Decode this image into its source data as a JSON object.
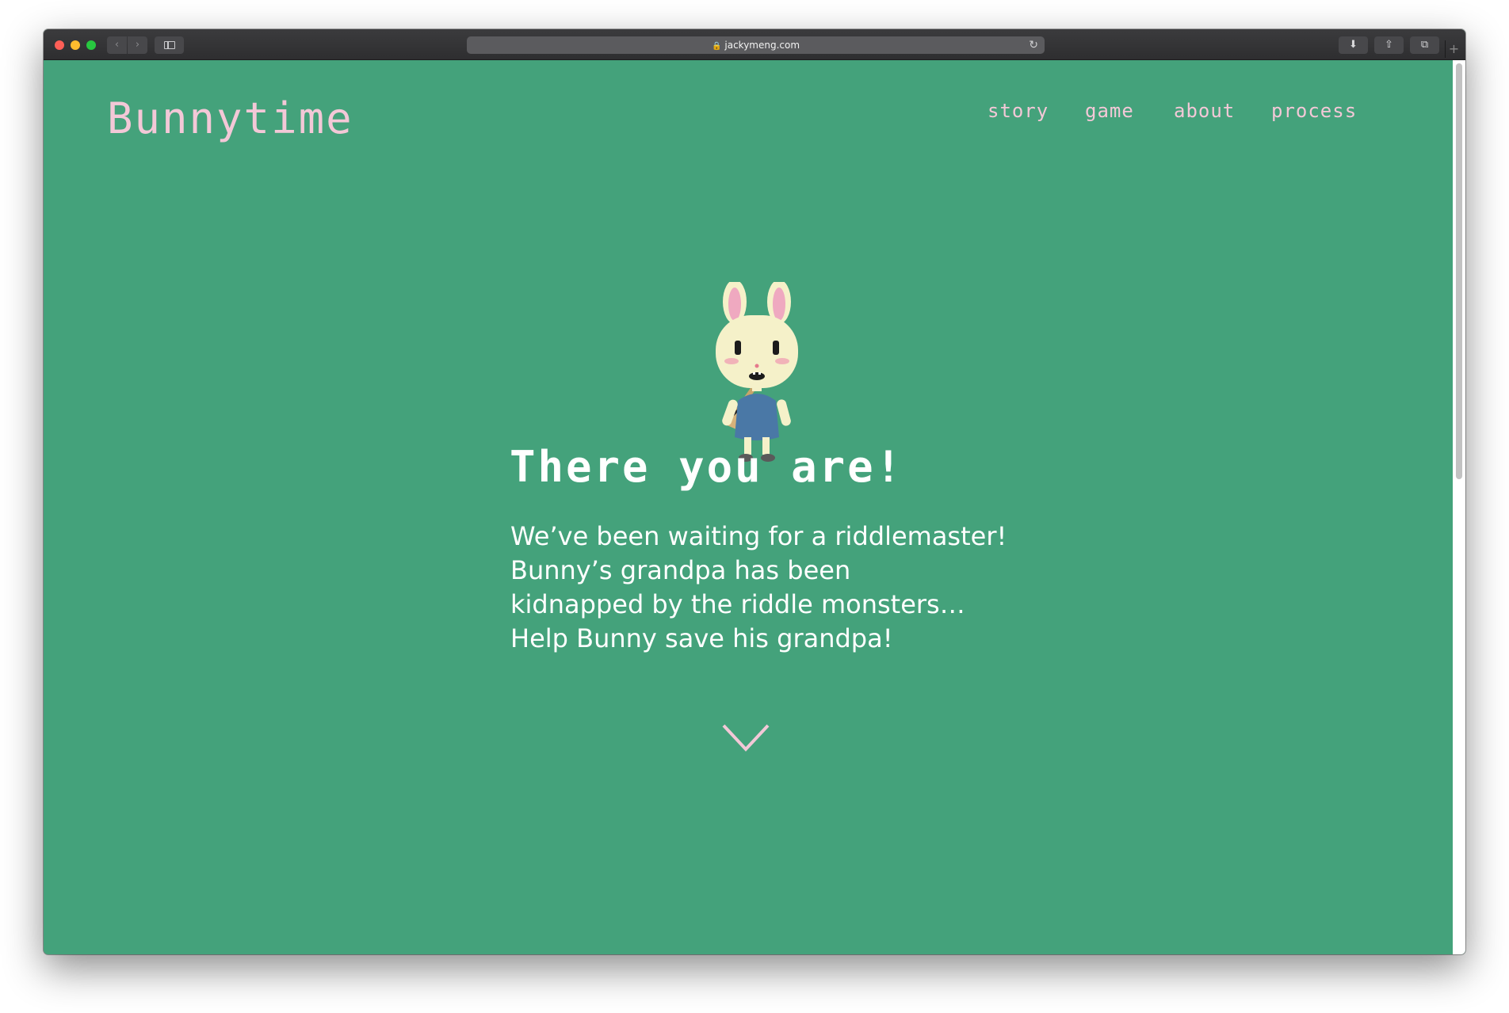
{
  "browser": {
    "url": "jackymeng.com",
    "back_glyph": "‹",
    "forward_glyph": "›",
    "reload_glyph": "↻",
    "download_glyph": "⬇",
    "share_glyph": "⇧",
    "tabs_glyph": "⧉",
    "new_tab_glyph": "+"
  },
  "site": {
    "logo": "Bunnytime",
    "nav": [
      {
        "label": "story"
      },
      {
        "label": "game"
      },
      {
        "label": "about"
      },
      {
        "label": "process"
      }
    ]
  },
  "hero": {
    "headline": "There you are!",
    "body_lines": [
      "We’ve been waiting for a riddlemaster!",
      "Bunny’s grandpa has been",
      "kidnapped by the riddle monsters…",
      "Help Bunny save his grandpa!"
    ]
  },
  "colors": {
    "page_bg": "#44a27b",
    "accent_pink": "#f3c8d7",
    "text_white": "#ffffff"
  },
  "icons": {
    "scroll_down": "chevron-down-icon",
    "character": "bunny-illustration"
  }
}
